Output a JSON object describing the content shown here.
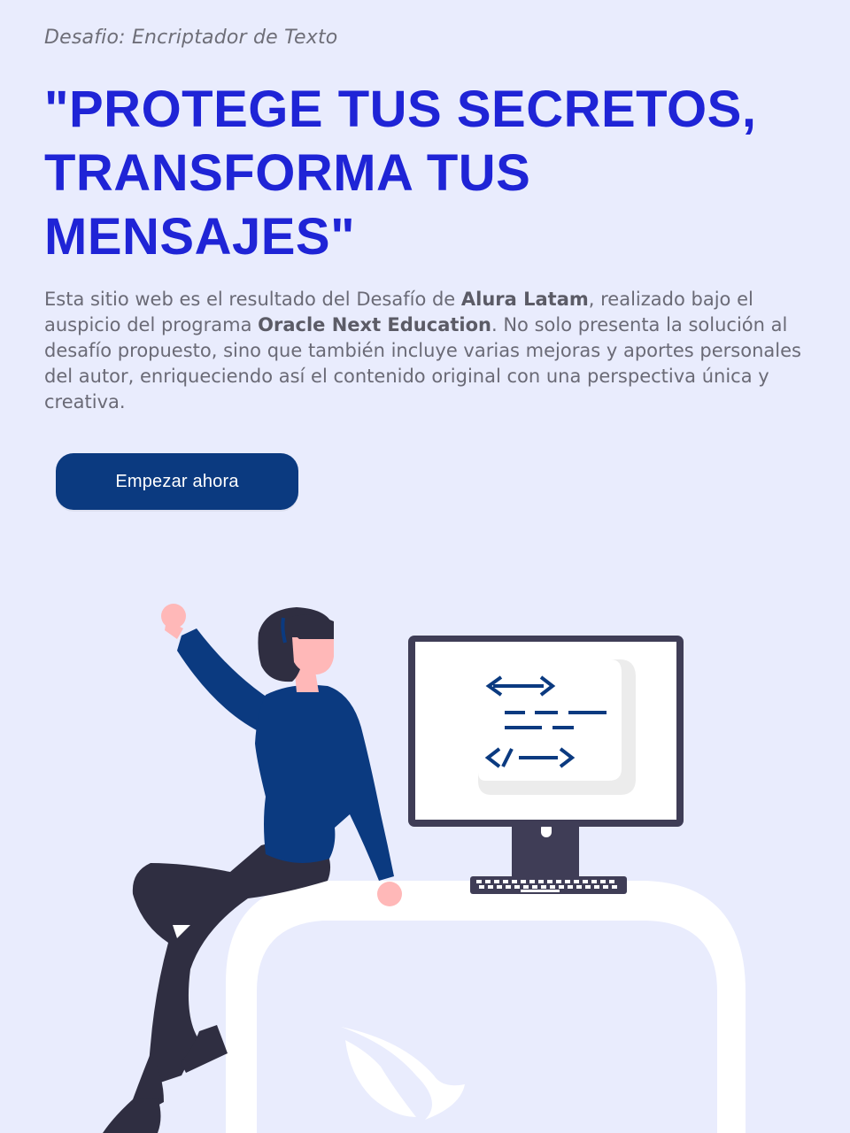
{
  "hero": {
    "eyebrow": "Desafio: Encriptador de Texto",
    "headline": "\"PROTEGE TUS SECRETOS, TRANSFORMA TUS MENSAJES\"",
    "intro": {
      "part1": "Esta sitio web es el resultado del Desafío de ",
      "bold1": "Alura Latam",
      "part2": ", realizado bajo el auspicio del programa ",
      "bold2": "Oracle Next Education",
      "part3": ". No solo presenta la solución al desafío propuesto, sino que también incluye varias mejoras y aportes personales del autor, enriqueciendo así el contenido original con una perspectiva única y creativa."
    },
    "cta_label": "Empezar ahora"
  },
  "illustration": {
    "icon": "woman-at-computer-illustration",
    "screen_icon": "code-document-icon"
  },
  "colors": {
    "background": "#e9ecfd",
    "headline": "#1f24d6",
    "button": "#0b3a80",
    "shirt": "#0b3a80",
    "pants": "#2f2e41",
    "skin": "#ffb8b8"
  }
}
